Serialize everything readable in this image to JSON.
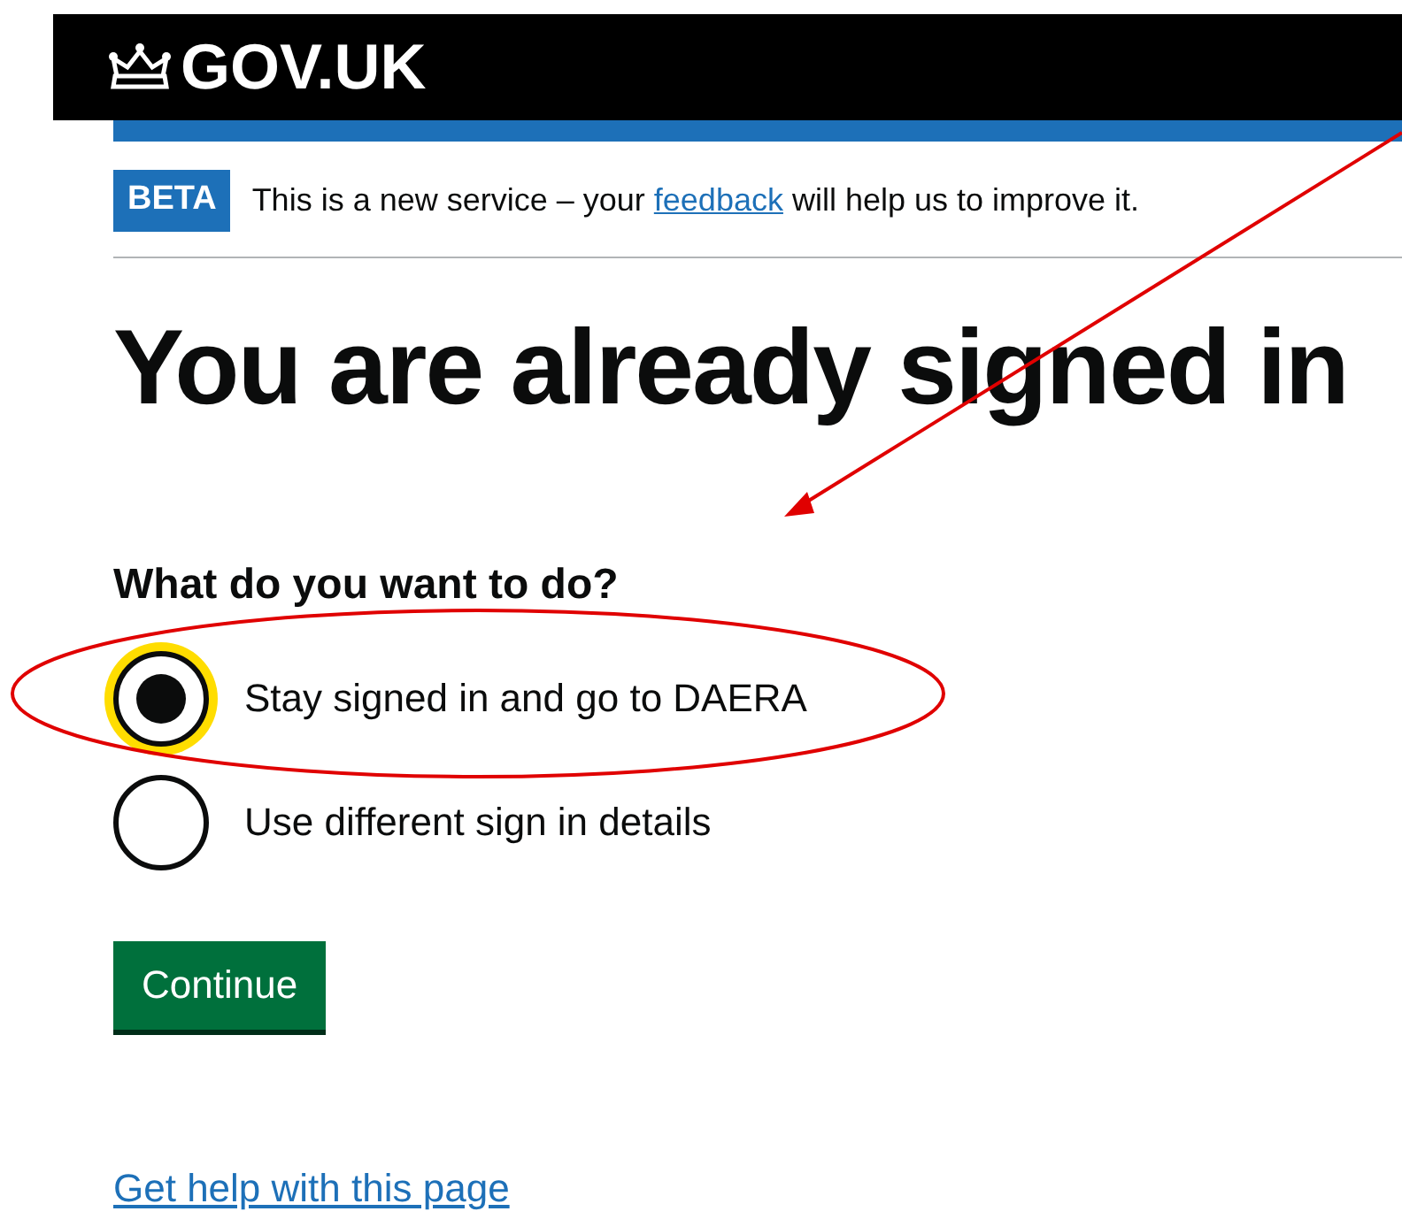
{
  "header": {
    "logo": "GOV.UK"
  },
  "phase_banner": {
    "tag": "BETA",
    "text_before": "This is a new service – your ",
    "link": "feedback",
    "text_after": " will help us to improve it."
  },
  "heading": "You are already signed in",
  "question": "What do you want to do?",
  "options": [
    {
      "label": "Stay signed in and go to DAERA",
      "selected": true,
      "focused": true
    },
    {
      "label": "Use different sign in details",
      "selected": false,
      "focused": false
    }
  ],
  "button": "Continue",
  "help_link": "Get help with this page"
}
